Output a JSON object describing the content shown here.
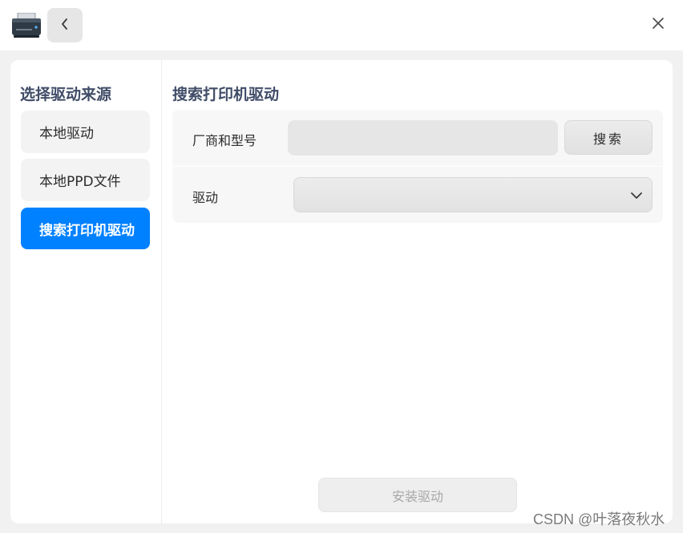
{
  "titlebar": {
    "app_icon": "printer-icon",
    "back_icon": "chevron-left-icon",
    "close_icon": "close-icon"
  },
  "sidebar": {
    "title": "选择驱动来源",
    "items": [
      {
        "label": "本地驱动",
        "active": false
      },
      {
        "label": "本地PPD文件",
        "active": false
      },
      {
        "label": "搜索打印机驱动",
        "active": true
      }
    ]
  },
  "main": {
    "title": "搜索打印机驱动",
    "model_label": "厂商和型号",
    "model_value": "",
    "search_label": "搜索",
    "driver_label": "驱动",
    "driver_value": "",
    "dropdown_icon": "chevron-down-icon",
    "install_label": "安装驱动"
  },
  "colors": {
    "accent": "#0081ff",
    "heading": "#414d68"
  },
  "watermark": "CSDN @叶落夜秋水"
}
